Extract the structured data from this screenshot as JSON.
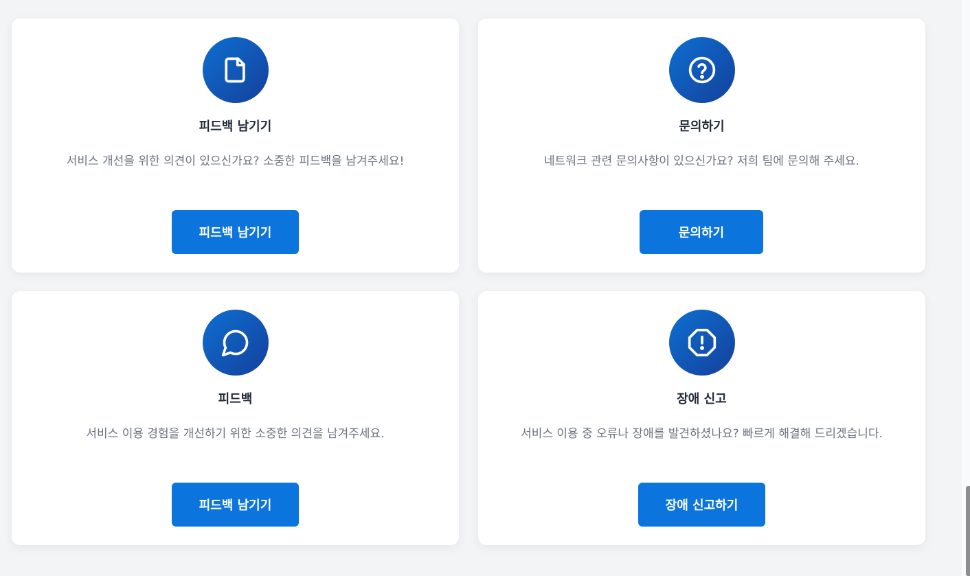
{
  "cards": [
    {
      "icon": "file-icon",
      "title": "피드백 남기기",
      "description": "서비스 개선을 위한 의견이 있으신가요? 소중한 피드백을 남겨주세요!",
      "button": "피드백 남기기"
    },
    {
      "icon": "question-circle-icon",
      "title": "문의하기",
      "description": "네트워크 관련 문의사항이 있으신가요? 저희 팀에 문의해 주세요.",
      "button": "문의하기"
    },
    {
      "icon": "chat-bubble-icon",
      "title": "피드백",
      "description": "서비스 이용 경험을 개선하기 위한 소중한 의견을 남겨주세요.",
      "button": "피드백 남기기"
    },
    {
      "icon": "alert-octagon-icon",
      "title": "장애 신고",
      "description": "서비스 이용 중 오류나 장애를 발견하셨나요? 빠르게 해결해 드리겠습니다.",
      "button": "장애 신고하기"
    }
  ],
  "colors": {
    "accent": "#0b74dd",
    "icon_gradient_start": "#0d6fd1",
    "icon_gradient_end": "#15409c",
    "page_background": "#f3f4f6"
  }
}
